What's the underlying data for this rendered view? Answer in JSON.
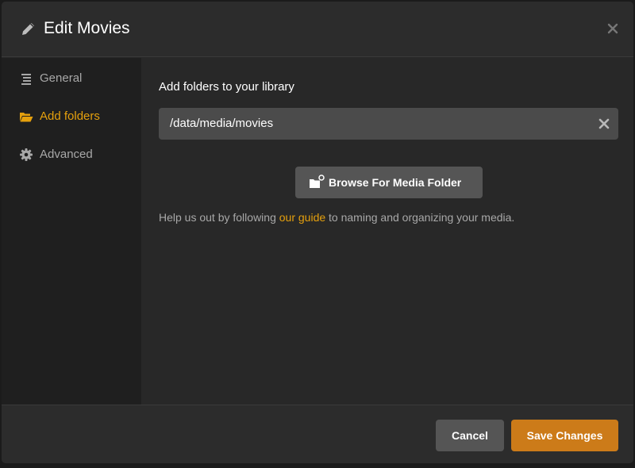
{
  "dialog": {
    "title": "Edit Movies",
    "title_icon": "pencil-icon",
    "close_icon": "close-icon"
  },
  "sidebar": {
    "items": [
      {
        "label": "General",
        "icon": "list-icon",
        "active": false
      },
      {
        "label": "Add folders",
        "icon": "folder-open-icon",
        "active": true
      },
      {
        "label": "Advanced",
        "icon": "gear-icon",
        "active": false
      }
    ]
  },
  "content": {
    "section_title": "Add folders to your library",
    "folders": [
      {
        "path": "/data/media/movies",
        "remove_icon": "remove-icon"
      }
    ],
    "browse_label": "Browse For Media Folder",
    "browse_icon": "folder-add-icon",
    "help_prefix": "Help us out by following ",
    "help_link": "our guide",
    "help_suffix": " to naming and organizing your media."
  },
  "footer": {
    "cancel_label": "Cancel",
    "save_label": "Save Changes"
  },
  "colors": {
    "accent": "#e5a00d",
    "save_button": "#cc7b19",
    "background": "#282828",
    "sidebar": "#1f1f1f"
  }
}
